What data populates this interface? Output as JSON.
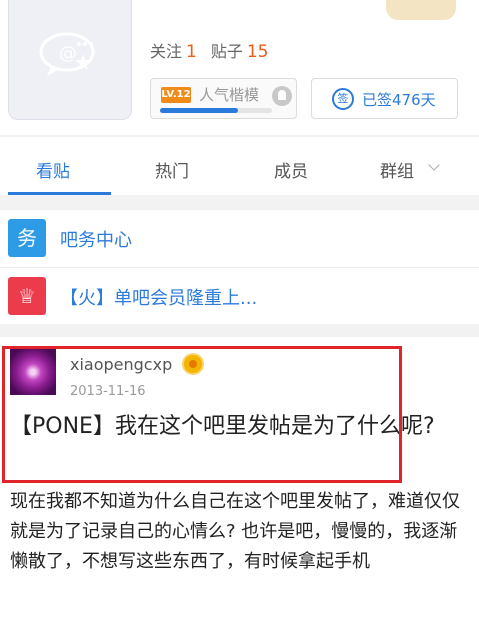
{
  "forum": {
    "follow_label": "关注",
    "follow_count": "1",
    "posts_label": "贴子",
    "posts_count": "15",
    "level_badge": "LV.12",
    "level_title": "人气楷模",
    "level_progress": 0.7,
    "signin_label": "已签476天",
    "signin_icon": "签"
  },
  "tabs": [
    {
      "label": "看贴",
      "active": true
    },
    {
      "label": "热门"
    },
    {
      "label": "成员"
    },
    {
      "label": "群组"
    }
  ],
  "links": [
    {
      "icon_char": "务",
      "icon": "service-icon",
      "color": "#2e9be6",
      "label": "吧务中心"
    },
    {
      "icon_char": "♕",
      "icon": "crown-icon",
      "color": "#ec3b4b",
      "label": "【火】单吧会员隆重上..."
    }
  ],
  "post": {
    "author": "xiaopengcxp",
    "date": "2013-11-16",
    "title": "【PONE】我在这个吧里发帖是为了什么呢?",
    "body": "现在我都不知道为什么自己在这个吧里发帖了，难道仅仅就是为了记录自己的心情么? 也许是吧，慢慢的，我逐渐懒散了，不想写这些东西了，有时候拿起手机"
  },
  "colors": {
    "accent": "#2b7bdc",
    "count": "#f05a1a",
    "highlight": "#e0242b"
  }
}
